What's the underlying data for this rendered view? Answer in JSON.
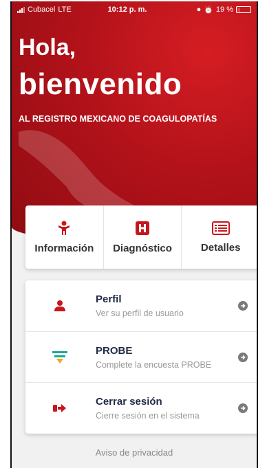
{
  "status_bar": {
    "carrier": "Cubacel",
    "network": "LTE",
    "time": "10:12 p. m.",
    "battery": "19 %"
  },
  "hero": {
    "greeting": "Hola,",
    "welcome": "bienvenido",
    "subtitle": "AL REGISTRO MEXICANO DE COAGULOPATÍAS"
  },
  "quick_actions": [
    {
      "label": "Información",
      "icon": "person-icon"
    },
    {
      "label": "Diagnóstico",
      "icon": "hospital-icon"
    },
    {
      "label": "Detalles",
      "icon": "list-icon"
    }
  ],
  "menu": [
    {
      "title": "Perfil",
      "subtitle": "Ver su perfil de usuario",
      "icon": "user-icon"
    },
    {
      "title": "PROBE",
      "subtitle": "Complete la encuesta PROBE",
      "icon": "funnel-icon"
    },
    {
      "title": "Cerrar sesión",
      "subtitle": "Cierre sesión en el sistema",
      "icon": "logout-icon"
    }
  ],
  "footer": {
    "privacy": "Aviso de privacidad"
  },
  "colors": {
    "brand_red": "#c8161d",
    "funnel_teal": "#1aa89a",
    "funnel_orange": "#f5a623"
  }
}
